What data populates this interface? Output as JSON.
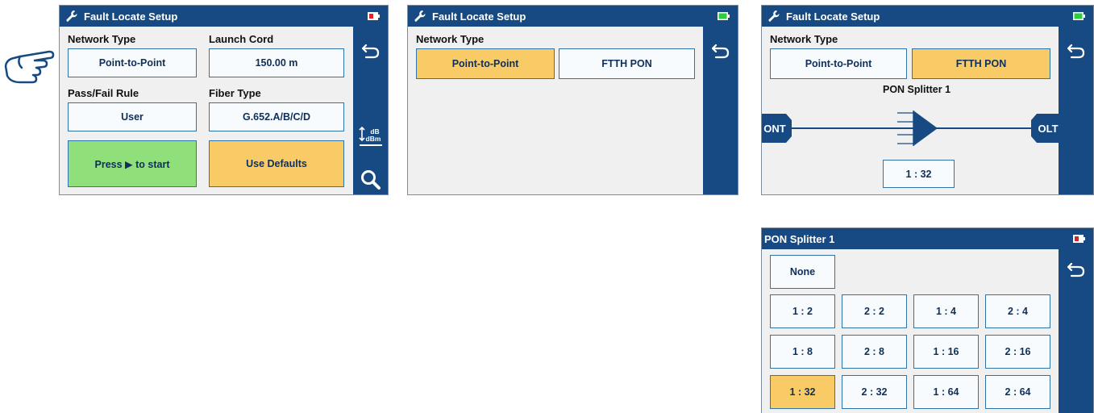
{
  "screens": {
    "s1": {
      "title": "Fault Locate Setup",
      "battery": "low",
      "labels": {
        "network_type": "Network Type",
        "launch_cord": "Launch Cord",
        "pass_fail": "Pass/Fail Rule",
        "fiber_type": "Fiber Type"
      },
      "values": {
        "network_type": "Point-to-Point",
        "launch_cord": "150.00 m",
        "pass_fail": "User",
        "fiber_type": "G.652.A/B/C/D"
      },
      "start_label": "Press ▶ to start",
      "defaults_label": "Use Defaults",
      "sidebar": {
        "db": "dB",
        "dbm": "dBm"
      }
    },
    "s2": {
      "title": "Fault Locate Setup",
      "battery": "full",
      "label": "Network Type",
      "options": [
        "Point-to-Point",
        "FTTH PON"
      ],
      "selected": "Point-to-Point"
    },
    "s3": {
      "title": "Fault Locate Setup",
      "battery": "full",
      "label": "Network Type",
      "options": [
        "Point-to-Point",
        "FTTH PON"
      ],
      "selected": "FTTH PON",
      "splitter_title": "PON Splitter 1",
      "ont": "ONT",
      "olt": "OLT",
      "ratio": "1 : 32"
    },
    "s4": {
      "title": "PON Splitter 1",
      "battery": "low",
      "none_label": "None",
      "ratios": [
        "1 : 2",
        "2 : 2",
        "1 : 4",
        "2 : 4",
        "1 : 8",
        "2 : 8",
        "1 : 16",
        "2 : 16",
        "1 : 32",
        "2 : 32",
        "1 : 64",
        "2 : 64"
      ],
      "selected": "1 : 32"
    }
  },
  "colors": {
    "bar": "#174a82",
    "selected": "#f8cb66",
    "start": "#8fe07b",
    "field_border": "#2f73a8",
    "battery_low": "#e0232b",
    "battery_full": "#2ecc40"
  },
  "icons": [
    "wrench-icon",
    "battery-icon",
    "back-icon",
    "db-dbm-icon",
    "search-icon",
    "pointing-hand-icon"
  ]
}
